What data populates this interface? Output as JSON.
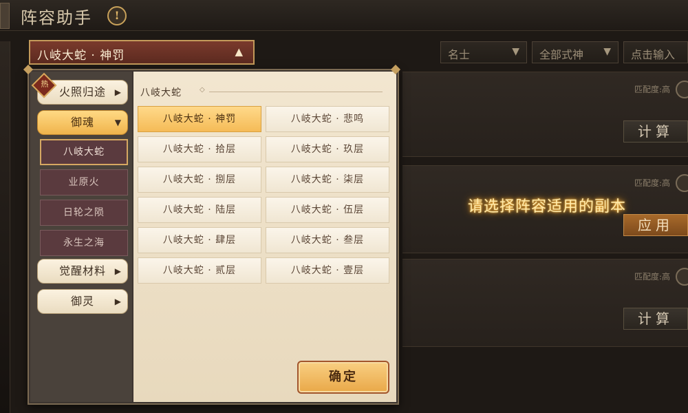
{
  "header": {
    "title": "阵容助手",
    "info_icon": "!"
  },
  "filters": {
    "shikigami_type": "名士",
    "shikigami_scope": "全部式神",
    "search_placeholder": "点击输入"
  },
  "dropdown": {
    "selected": "八岐大蛇 · 神罚",
    "categories": [
      {
        "label": "火照归途",
        "arrow": "▶",
        "badge": "热"
      },
      {
        "label": "御魂",
        "arrow": "▼"
      },
      {
        "label": "觉醒材料",
        "arrow": "▶"
      },
      {
        "label": "御灵",
        "arrow": "▶"
      }
    ],
    "subcategories": [
      "八岐大蛇",
      "业原火",
      "日轮之陨",
      "永生之海"
    ],
    "section_title": "八岐大蛇",
    "options": [
      "八岐大蛇 · 神罚",
      "八岐大蛇 · 悲鸣",
      "八岐大蛇 · 拾层",
      "八岐大蛇 · 玖层",
      "八岐大蛇 · 捌层",
      "八岐大蛇 · 柒层",
      "八岐大蛇 · 陆层",
      "八岐大蛇 · 伍层",
      "八岐大蛇 · 肆层",
      "八岐大蛇 · 叁层",
      "八岐大蛇 · 贰层",
      "八岐大蛇 · 壹层"
    ],
    "confirm_label": "确定"
  },
  "background_cards": [
    {
      "match": "匹配度:高",
      "button": "计算"
    },
    {
      "match": "匹配度:高",
      "button": "应用"
    },
    {
      "match": "匹配度:高",
      "button": "计算"
    }
  ],
  "hint": "请选择阵容适用的副本",
  "colors": {
    "accent_gold": "#f5bb57",
    "dropdown_red": "#7a3a2c",
    "hint_glow": "#ffb43b"
  }
}
